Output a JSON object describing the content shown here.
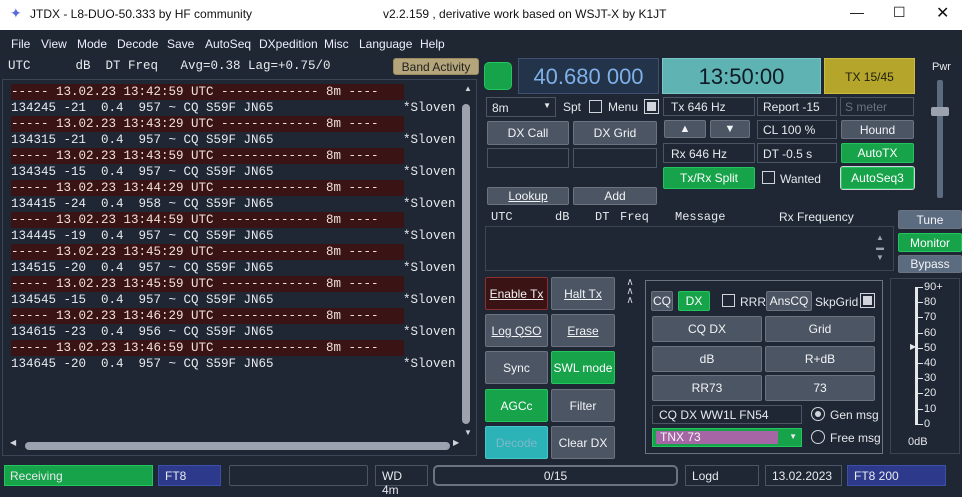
{
  "window": {
    "title": "JTDX - L8-DUO-50.333  by HF community",
    "subtitle": "v2.2.159 , derivative work based on WSJT-X by K1JT"
  },
  "menu": [
    "File",
    "View",
    "Mode",
    "Decode",
    "Save",
    "AutoSeq",
    "DXpedition",
    "Misc",
    "Language",
    "Help"
  ],
  "decode_header": "UTC      dB  DT Freq   Avg=0.38 Lag=+0.75/0",
  "band_activity": "Band Activity",
  "decodes": [
    {
      "type": "sep",
      "text": "----- 13.02.23 13:42:59 UTC ------------- 8m ----"
    },
    {
      "type": "dec",
      "text": "134245 -21  0.4  957 ~ CQ S59F JN65",
      "tail": "*Sloven"
    },
    {
      "type": "sep",
      "text": "----- 13.02.23 13:43:29 UTC ------------- 8m ----"
    },
    {
      "type": "dec",
      "text": "134315 -21  0.4  957 ~ CQ S59F JN65",
      "tail": "*Sloven"
    },
    {
      "type": "sep",
      "text": "----- 13.02.23 13:43:59 UTC ------------- 8m ----"
    },
    {
      "type": "dec",
      "text": "134345 -15  0.4  957 ~ CQ S59F JN65",
      "tail": "*Sloven"
    },
    {
      "type": "sep",
      "text": "----- 13.02.23 13:44:29 UTC ------------- 8m ----"
    },
    {
      "type": "dec",
      "text": "134415 -24  0.4  958 ~ CQ S59F JN65",
      "tail": "*Sloven"
    },
    {
      "type": "sep",
      "text": "----- 13.02.23 13:44:59 UTC ------------- 8m ----"
    },
    {
      "type": "dec",
      "text": "134445 -19  0.4  957 ~ CQ S59F JN65",
      "tail": "*Sloven"
    },
    {
      "type": "sep",
      "text": "----- 13.02.23 13:45:29 UTC ------------- 8m ----"
    },
    {
      "type": "dec",
      "text": "134515 -20  0.4  957 ~ CQ S59F JN65",
      "tail": "*Sloven"
    },
    {
      "type": "sep",
      "text": "----- 13.02.23 13:45:59 UTC ------------- 8m ----"
    },
    {
      "type": "dec",
      "text": "134545 -15  0.4  957 ~ CQ S59F JN65",
      "tail": "*Sloven"
    },
    {
      "type": "sep",
      "text": "----- 13.02.23 13:46:29 UTC ------------- 8m ----"
    },
    {
      "type": "dec",
      "text": "134615 -23  0.4  956 ~ CQ S59F JN65",
      "tail": "*Sloven"
    },
    {
      "type": "sep",
      "text": "----- 13.02.23 13:46:59 UTC ------------- 8m ----"
    },
    {
      "type": "dec",
      "text": "134645 -20  0.4  957 ~ CQ S59F JN65",
      "tail": "*Sloven"
    }
  ],
  "frequency": "40.680 000",
  "clock": "13:50:00",
  "tx_counter": "TX 15/45",
  "band": "8m",
  "spt": "Spt",
  "menu_label": "Menu",
  "dx_call": "DX Call",
  "dx_grid": "DX Grid",
  "lookup": "Lookup",
  "add": "Add",
  "tx_freq": "Tx  646  Hz",
  "rx_freq": "Rx  646  Hz",
  "report": "Report -15",
  "smeter_placeholder": "S meter",
  "cl": "CL  100 %",
  "dt": "DT -0.5 s",
  "hound": "Hound",
  "autotx": "AutoTX",
  "autoseq3": "AutoSeq3",
  "txrx_split": "Tx/Rx Split",
  "wanted": "Wanted",
  "pwr": "Pwr",
  "rx_header": {
    "utc": "UTC",
    "db": "dB",
    "dt": "DT",
    "freq": "Freq",
    "message": "Message",
    "rxfreq": "Rx Frequency"
  },
  "tune": "Tune",
  "monitor": "Monitor",
  "bypass": "Bypass",
  "enable_tx": "Enable Tx",
  "halt_tx": "Halt Tx",
  "log_qso": "Log QSO",
  "erase": "Erase",
  "sync": "Sync",
  "swl_mode": "SWL mode",
  "agcc": "AGCc",
  "filter": "Filter",
  "decode": "Decode",
  "clear_dx": "Clear DX",
  "cq": "CQ",
  "dx": "DX",
  "rrr": "RRR",
  "anscq": "AnsCQ",
  "skpgrid": "SkpGrid",
  "msg_buttons": [
    "CQ DX",
    "Grid",
    "dB",
    "R+dB",
    "RR73",
    "73"
  ],
  "gen_msg_text": "CQ DX WW1L FN54",
  "gen_msg": "Gen msg",
  "free_msg_text": "TNX 73",
  "free_msg": "Free msg",
  "meter_ticks": [
    "90+",
    "80",
    "70",
    "60",
    "50",
    "40",
    "30",
    "20",
    "10",
    "0"
  ],
  "meter_unit": "0dB",
  "status": {
    "state": "Receiving",
    "mode": "FT8",
    "wd": "WD 4m",
    "progress": "0/15",
    "logd": "Logd",
    "date": "13.02.2023",
    "mode2": "FT8  200"
  },
  "colors": {
    "accent_green": "#16a34a",
    "freq_bg": "#22334a",
    "clock_bg": "#5fb3b3",
    "tx_bg": "#b5a52a",
    "separator": "#3a1414",
    "teal": "#2bb3b8",
    "purple": "#a666a6",
    "status_blue": "#2d3a8c"
  }
}
